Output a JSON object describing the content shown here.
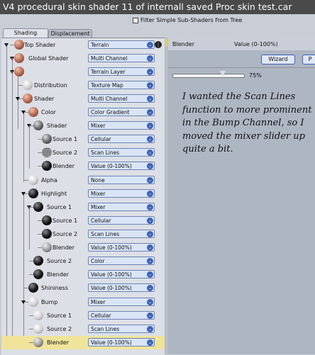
{
  "window": {
    "title": "V4 procedural skin shader 11 of internall saved Proc skin test.car"
  },
  "filter": {
    "label": "Filter Simple Sub-Shaders from Tree",
    "checked": false
  },
  "tabs": [
    {
      "label": "Shading",
      "active": true
    },
    {
      "label": "Displacement",
      "active": false
    }
  ],
  "tree": {
    "rows": [
      {
        "label": "Top Shader",
        "value": "Terrain",
        "ball": "skin",
        "selected": false
      },
      {
        "label": "Global Shader",
        "value": "Multi Channel",
        "ball": "skin",
        "selected": false
      },
      {
        "label": "",
        "value": "Terrain Layer",
        "ball": "skin",
        "selected": false
      },
      {
        "label": "Distribution",
        "value": "Texture Map",
        "ball": "white",
        "selected": false
      },
      {
        "label": "Shader",
        "value": "Multi Channel",
        "ball": "skin",
        "selected": false
      },
      {
        "label": "Color",
        "value": "Color Gradient",
        "ball": "skin",
        "selected": false
      },
      {
        "label": "Shader",
        "value": "Mixer",
        "ball": "noise",
        "selected": false
      },
      {
        "label": "Source 1",
        "value": "Cellular",
        "ball": "noise",
        "selected": false
      },
      {
        "label": "Source 2",
        "value": "Scan Lines",
        "ball": "stripe",
        "selected": false
      },
      {
        "label": "Blender",
        "value": "Value (0-100%)",
        "ball": "black",
        "selected": false
      },
      {
        "label": "Alpha",
        "value": "None",
        "ball": "white",
        "selected": false
      },
      {
        "label": "Highlight",
        "value": "Mixer",
        "ball": "black",
        "selected": false
      },
      {
        "label": "Source 1",
        "value": "Mixer",
        "ball": "black",
        "selected": false
      },
      {
        "label": "Source 1",
        "value": "Cellular",
        "ball": "black",
        "selected": false
      },
      {
        "label": "Source 2",
        "value": "Scan Lines",
        "ball": "black",
        "selected": false
      },
      {
        "label": "Blender",
        "value": "Value (0-100%)",
        "ball": "grey",
        "selected": false
      },
      {
        "label": "Source 2",
        "value": "Color",
        "ball": "black",
        "selected": false
      },
      {
        "label": "Blender",
        "value": "Value (0-100%)",
        "ball": "black",
        "selected": false
      },
      {
        "label": "Shininess",
        "value": "Value (0-100%)",
        "ball": "black",
        "selected": false
      },
      {
        "label": "Bump",
        "value": "Mixer",
        "ball": "white",
        "selected": false
      },
      {
        "label": "Source 1",
        "value": "Cellular",
        "ball": "white",
        "selected": false
      },
      {
        "label": "Source 2",
        "value": "Scan Lines",
        "ball": "white",
        "selected": false
      },
      {
        "label": "Blender",
        "value": "Value (0-100%)",
        "ball": "grey",
        "selected": true
      }
    ]
  },
  "detail": {
    "name": "Blender",
    "type": "Value (0-100%)",
    "wizard_label": "Wizard",
    "p_label": "P",
    "slider_value": 0.75,
    "slider_label": "75%"
  },
  "annotation": "I wanted the Scan Lines function to more prominent in the Bump Channel, so I moved the mixer slider up quite a bit.",
  "colors": {
    "selected_row": "#efe49a",
    "dropdown_accent": "#3b63b8",
    "title_bar": "#4a4a4a"
  }
}
